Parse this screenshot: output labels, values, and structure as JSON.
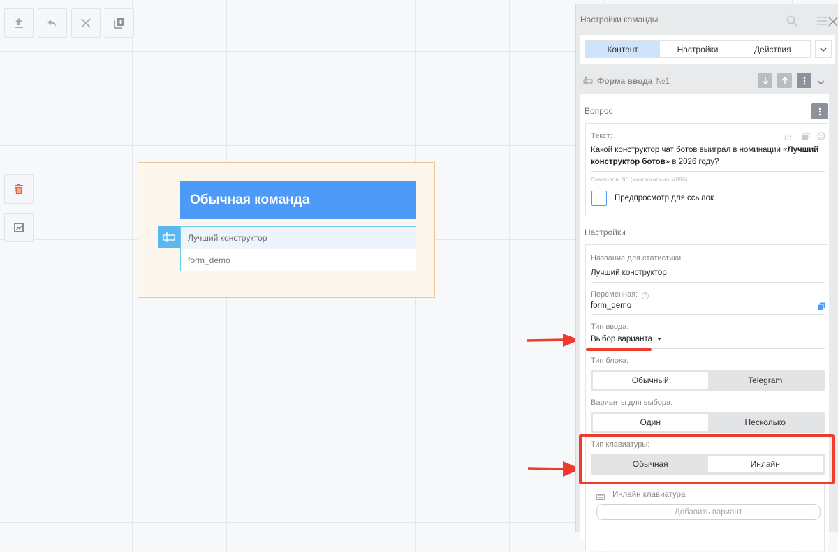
{
  "canvas": {
    "node": {
      "title": "Обычная команда",
      "stat_name": "Лучший конструктор",
      "variable": "form_demo"
    }
  },
  "panel": {
    "title": "Настройки команды",
    "tabs": [
      "Контент",
      "Настройки",
      "Действия"
    ],
    "form_name": "Форма ввода",
    "form_number": "№1",
    "question_label": "Вопрос",
    "text_label": "Текст:",
    "question_text_1": "Какой конструктор чат ботов выиграл в номинации «",
    "question_text_bold": "Лучший конструктор ботов",
    "question_text_2": "» в 2026 году?",
    "char_count": "Символов: 96 (максимально: 4096)",
    "preview_label": "Предпросмотр для ссылок",
    "settings_label": "Настройки",
    "stat_name_label": "Название для статистики:",
    "stat_name_value": "Лучший конструктор",
    "variable_label": "Переменная:",
    "variable_value": "form_demo",
    "input_type_label": "Тип ввода:",
    "input_type_value": "Выбор варианта",
    "block_type_label": "Тип блока:",
    "block_type_options": [
      "Обычный",
      "Telegram"
    ],
    "choice_label": "Варианты для выбора:",
    "choice_options": [
      "Один",
      "Несколько"
    ],
    "keyboard_type_label": "Тип клавиатуры:",
    "keyboard_type_options": [
      "Обычная",
      "Инлайн"
    ],
    "inline_keyboard_label": "Инлайн клавиатура",
    "add_option_button": "Добавить вариант"
  }
}
